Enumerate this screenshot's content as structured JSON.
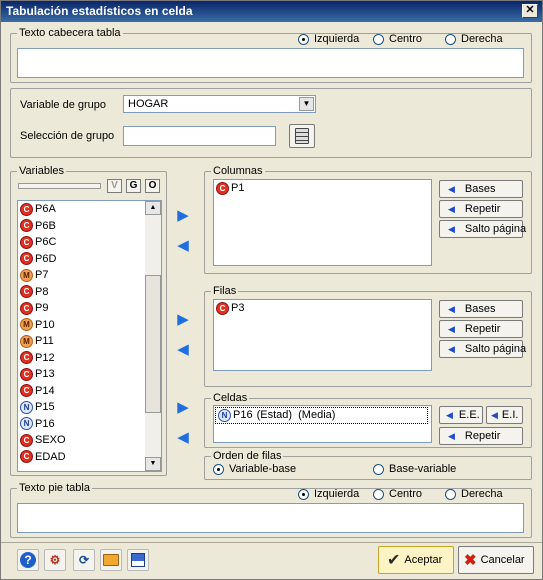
{
  "window": {
    "title": "Tabulación estadísticos en celda",
    "close": "✕"
  },
  "header": {
    "caption": "Texto cabecera tabla",
    "align": [
      "Izquierda",
      "Centro",
      "Derecha"
    ],
    "selected": "Izquierda",
    "text": ""
  },
  "group": {
    "variable_label": "Variable de grupo",
    "variable_value": "HOGAR",
    "seleccion_label": "Selección de grupo",
    "seleccion_value": ""
  },
  "variables": {
    "caption": "Variables",
    "buttons": [
      "V",
      "G",
      "O"
    ],
    "items": [
      {
        "name": "P6A",
        "type": "C"
      },
      {
        "name": "P6B",
        "type": "C"
      },
      {
        "name": "P6C",
        "type": "C"
      },
      {
        "name": "P6D",
        "type": "C"
      },
      {
        "name": "P7",
        "type": "M"
      },
      {
        "name": "P8",
        "type": "C"
      },
      {
        "name": "P9",
        "type": "C"
      },
      {
        "name": "P10",
        "type": "M"
      },
      {
        "name": "P11",
        "type": "M"
      },
      {
        "name": "P12",
        "type": "C"
      },
      {
        "name": "P13",
        "type": "C"
      },
      {
        "name": "P14",
        "type": "C"
      },
      {
        "name": "P15",
        "type": "N"
      },
      {
        "name": "P16",
        "type": "N"
      },
      {
        "name": "SEXO",
        "type": "C"
      },
      {
        "name": "EDAD",
        "type": "C"
      }
    ]
  },
  "columnas": {
    "caption": "Columnas",
    "items": [
      {
        "name": "P1",
        "type": "C"
      }
    ],
    "buttons": [
      "Bases",
      "Repetir",
      "Salto página"
    ]
  },
  "filas": {
    "caption": "Filas",
    "items": [
      {
        "name": "P3",
        "type": "C"
      }
    ],
    "buttons": [
      "Bases",
      "Repetir",
      "Salto página"
    ]
  },
  "celdas": {
    "caption": "Celdas",
    "item": {
      "name": "P16",
      "type": "N",
      "extra": "(Estad)  (Media)"
    },
    "buttons": {
      "ee": "E.E.",
      "ei": "E.I.",
      "repetir": "Repetir"
    }
  },
  "orden": {
    "caption": "Orden de filas",
    "options": [
      "Variable-base",
      "Base-variable"
    ],
    "selected": "Variable-base"
  },
  "footer": {
    "caption": "Texto pie tabla",
    "align": [
      "Izquierda",
      "Centro",
      "Derecha"
    ],
    "selected": "Izquierda",
    "text": ""
  },
  "actions": {
    "accept": "Aceptar",
    "cancel": "Cancelar"
  },
  "icons": {
    "help": "help-icon",
    "filter": "filter-icon",
    "refresh": "refresh-icon",
    "open": "folder-icon",
    "save": "save-icon",
    "calc": "calculator-icon"
  },
  "colors": {
    "title_bar": "#0a246a",
    "accept_bg": "#fdf3c4",
    "accent_blue": "#1f6fe0",
    "badge_c": "#e03020"
  }
}
